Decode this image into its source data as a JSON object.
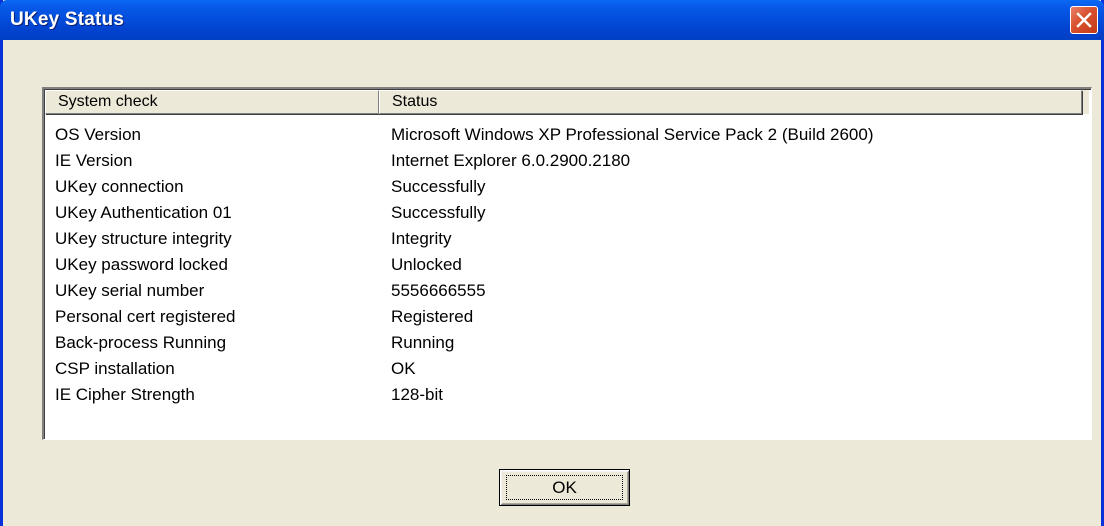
{
  "window": {
    "title": "UKey Status"
  },
  "table": {
    "columns": [
      "System check",
      "Status"
    ],
    "rows": [
      {
        "check": "OS Version",
        "status": "Microsoft Windows XP Professional Service Pack 2 (Build 2600)"
      },
      {
        "check": "IE Version",
        "status": "Internet Explorer 6.0.2900.2180"
      },
      {
        "check": "UKey connection",
        "status": "Successfully"
      },
      {
        "check": "UKey Authentication 01",
        "status": "Successfully"
      },
      {
        "check": "UKey structure integrity",
        "status": "Integrity"
      },
      {
        "check": "UKey password locked",
        "status": "Unlocked"
      },
      {
        "check": "UKey serial number",
        "status": "5556666555"
      },
      {
        "check": "Personal cert registered",
        "status": "Registered"
      },
      {
        "check": "Back-process Running",
        "status": "Running"
      },
      {
        "check": "CSP installation",
        "status": "OK"
      },
      {
        "check": "IE Cipher Strength",
        "status": "128-bit"
      }
    ]
  },
  "buttons": {
    "ok_label": "OK"
  },
  "icons": {
    "close": "close-icon"
  },
  "colors": {
    "titlebar": "#0451df",
    "close_button": "#d8502e",
    "dialog_face": "#ece9d8"
  }
}
